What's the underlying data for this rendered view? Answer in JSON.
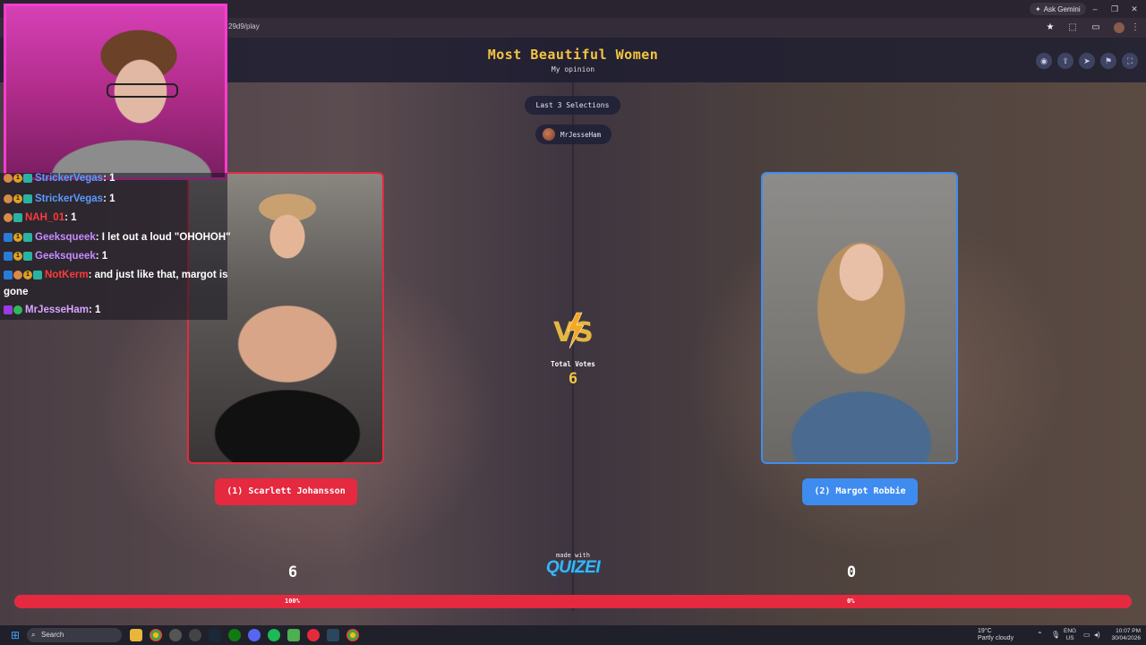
{
  "browser": {
    "url": "29d9/play",
    "gemini_label": "Ask Gemini",
    "minimize": "–",
    "restore": "❐",
    "close": "✕"
  },
  "page": {
    "title": "Most Beautiful Women",
    "subtitle": "My opinion",
    "last_selections_label": "Last 3 Selections",
    "last_voter": "MrJesseHam",
    "total_votes_label": "Total Votes",
    "total_votes": "6",
    "made_with": "made with",
    "logo_text": "QUIZEI",
    "header_buttons": [
      "eye-icon",
      "share-icon",
      "send-icon",
      "flag-icon",
      "fullscreen-icon"
    ]
  },
  "options": [
    {
      "label": "(1) Scarlett Johansson",
      "votes": "6",
      "percent_label": "100%",
      "percent": 100,
      "color": "#e5293f"
    },
    {
      "label": "(2) Margot Robbie",
      "votes": "0",
      "percent_label": "0%",
      "percent": 0,
      "color": "#3f8cf0"
    }
  ],
  "chat": [
    {
      "user": "StrickerVegas",
      "message": ": 1"
    },
    {
      "user": "StrickerVegas",
      "message": ": 1"
    },
    {
      "user": "NAH_01",
      "message": ": 1"
    },
    {
      "user": "Geeksqueek",
      "message": ": I let out a loud \"OHOHOH\""
    },
    {
      "user": "Geeksqueek",
      "message": ": 1"
    },
    {
      "user": "NotKerm",
      "message": ": and just like that, margot is",
      "continuation": "gone"
    },
    {
      "user": "MrJesseHam",
      "message": ": 1"
    }
  ],
  "taskbar": {
    "search_placeholder": "Search",
    "weather_temp": "19°C",
    "weather_desc": "Partly cloudy",
    "lang_top": "ENG",
    "lang_bottom": "US",
    "time": "10:07 PM",
    "date": "30/04/2026"
  }
}
